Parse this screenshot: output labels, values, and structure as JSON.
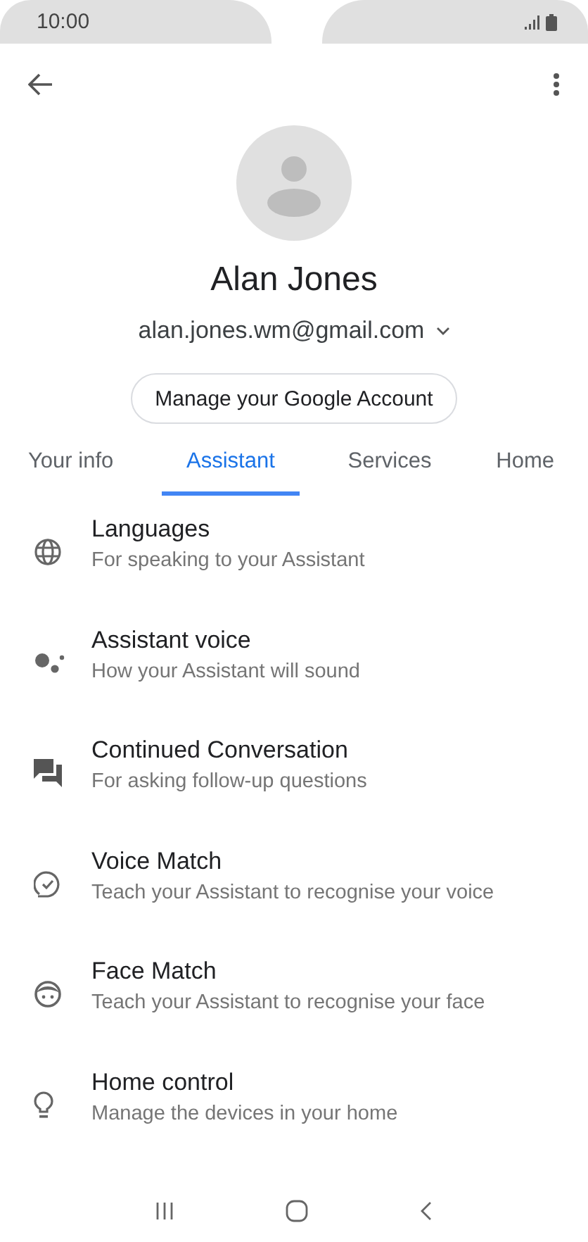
{
  "status_bar": {
    "time": "10:00"
  },
  "profile": {
    "name": "Alan Jones",
    "email": "alan.jones.wm@gmail.com",
    "manage_button": "Manage your Google Account"
  },
  "tabs": [
    {
      "label": "Your info",
      "selected": false
    },
    {
      "label": "Assistant",
      "selected": true
    },
    {
      "label": "Services",
      "selected": false
    },
    {
      "label": "Home",
      "selected": false
    }
  ],
  "settings": [
    {
      "title": "Languages",
      "subtitle": "For speaking to your Assistant"
    },
    {
      "title": "Assistant voice",
      "subtitle": "How your Assistant will sound"
    },
    {
      "title": "Continued Conversation",
      "subtitle": "For asking follow-up questions"
    },
    {
      "title": "Voice Match",
      "subtitle": "Teach your Assistant to recognise your voice"
    },
    {
      "title": "Face Match",
      "subtitle": "Teach your Assistant to recognise your face"
    },
    {
      "title": "Home control",
      "subtitle": "Manage the devices in your home"
    }
  ]
}
